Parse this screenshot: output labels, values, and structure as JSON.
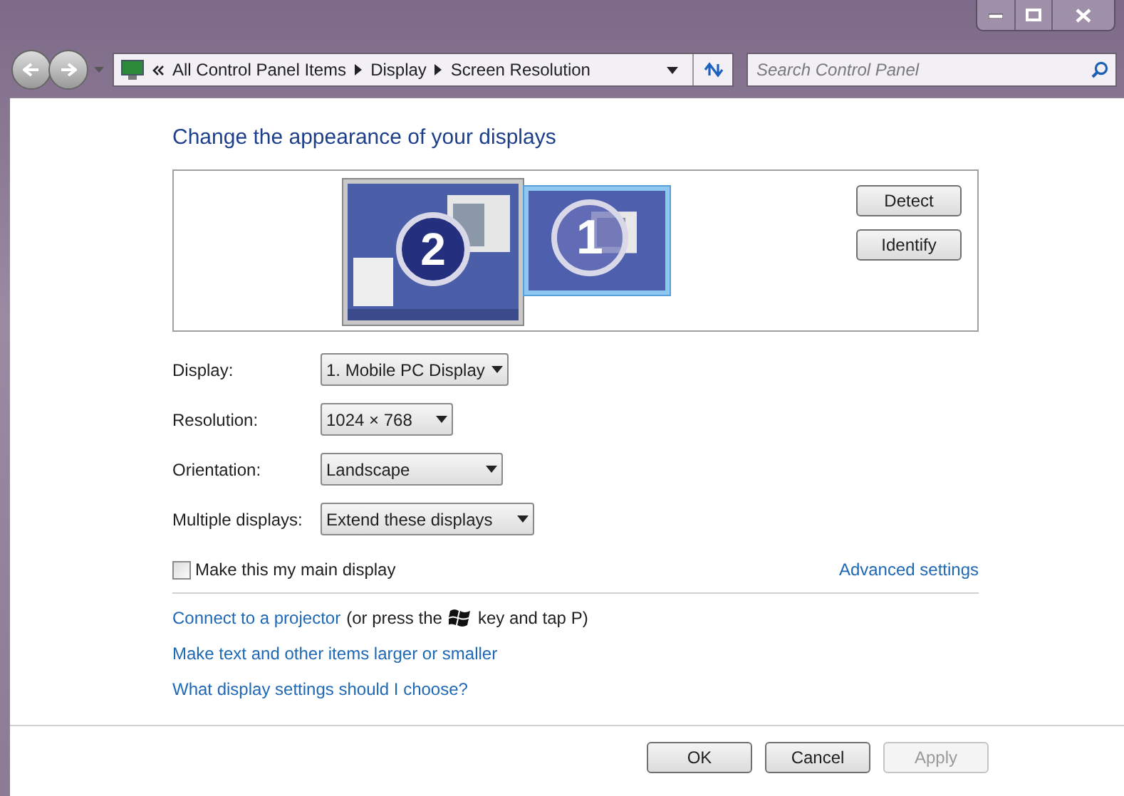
{
  "address_bar": {
    "crumbs": [
      "All Control Panel Items",
      "Display",
      "Screen Resolution"
    ]
  },
  "search": {
    "placeholder": "Search Control Panel"
  },
  "heading": "Change the appearance of your displays",
  "monitors": [
    {
      "number": "2",
      "selected": false
    },
    {
      "number": "1",
      "selected": true
    }
  ],
  "monitor_buttons": [
    "Detect",
    "Identify"
  ],
  "settings": [
    {
      "label": "Display:",
      "value": "1. Mobile PC Display"
    },
    {
      "label": "Resolution:",
      "value": "1024 × 768"
    },
    {
      "label": "Orientation:",
      "value": "Landscape"
    },
    {
      "label": "Multiple displays:",
      "value": "Extend these displays"
    }
  ],
  "main_display": {
    "label": "Make this my main display",
    "checked": false
  },
  "advanced_link": "Advanced settings",
  "projector": {
    "link": "Connect to a projector",
    "before_key": "(or press the",
    "after_key": "key and tap P)"
  },
  "links": [
    "Make text and other items larger or smaller",
    "What display settings should I choose?"
  ],
  "buttons": [
    {
      "label": "OK",
      "disabled": false
    },
    {
      "label": "Cancel",
      "disabled": false
    },
    {
      "label": "Apply",
      "disabled": true
    }
  ]
}
